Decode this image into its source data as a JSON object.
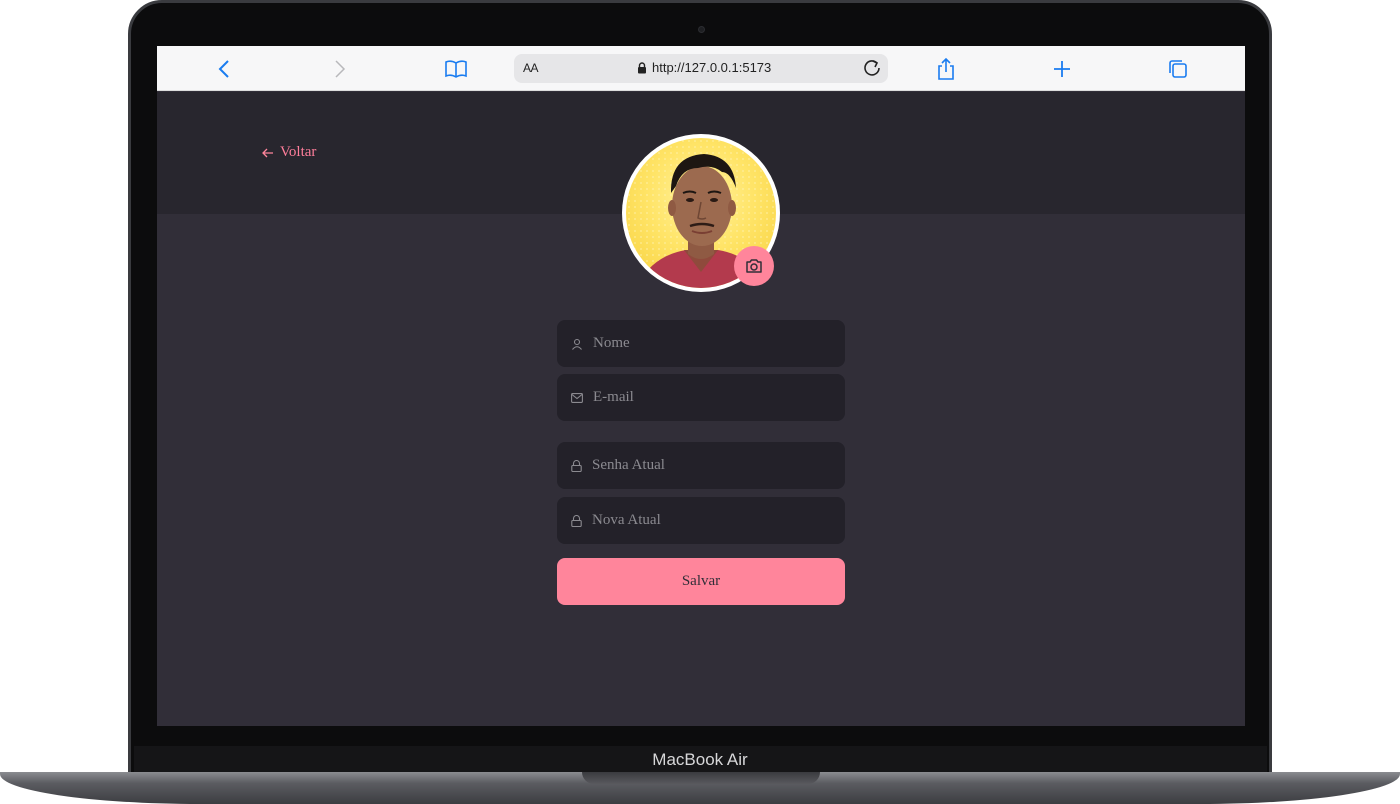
{
  "device": {
    "brand_label": "MacBook Air"
  },
  "browser": {
    "text_size_label": "AA",
    "url": "http://127.0.0.1:5173"
  },
  "page": {
    "back_label": "Voltar",
    "form": {
      "name_placeholder": "Nome",
      "email_placeholder": "E-mail",
      "current_password_placeholder": "Senha Atual",
      "new_password_placeholder": "Nova Atual",
      "save_label": "Salvar"
    }
  },
  "colors": {
    "accent": "#ff859b",
    "background": "#312e38",
    "header": "#28262e",
    "input": "#232129"
  }
}
